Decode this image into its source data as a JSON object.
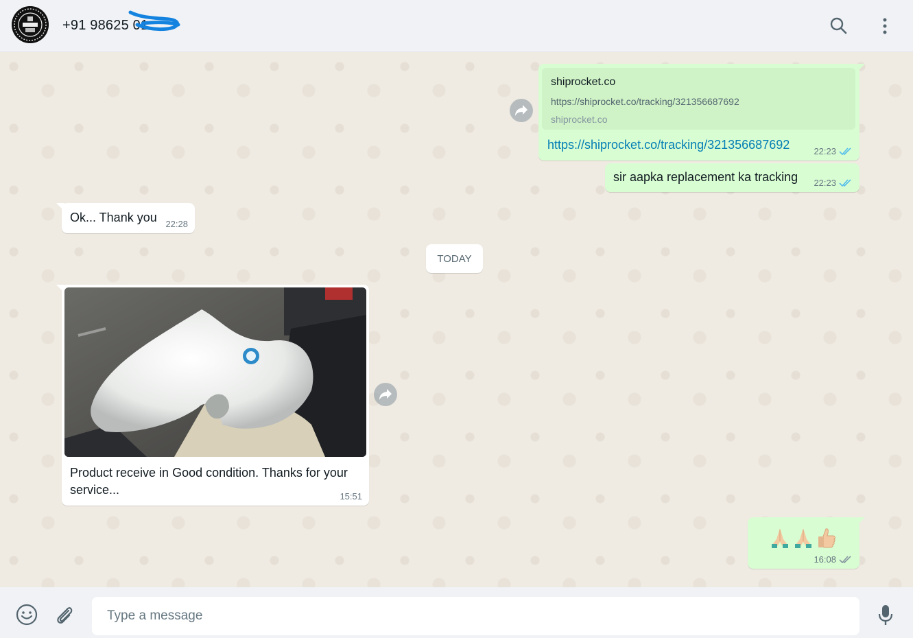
{
  "header": {
    "contact_name": "+91 98625 01",
    "search_icon": "search-icon",
    "menu_icon": "kebab-menu-icon"
  },
  "messages": {
    "link_preview": {
      "title": "shiprocket.co",
      "description": "https://shiprocket.co/tracking/321356687692",
      "host": "shiprocket.co",
      "link_text": "https://shiprocket.co/tracking/321356687692",
      "time": "22:23",
      "status": "read"
    },
    "tracking": {
      "text": "sir aapka replacement ka tracking",
      "time": "22:23",
      "status": "read"
    },
    "ok": {
      "text": "Ok... Thank you",
      "time": "22:28"
    },
    "date_divider": "TODAY",
    "photo": {
      "caption": "Product receive in Good condition. Thanks for your service...",
      "time": "15:51"
    },
    "emoji": {
      "emojis": "🙏🙏👍",
      "time": "16:08",
      "status": "read"
    }
  },
  "footer": {
    "placeholder": "Type a message",
    "value": ""
  },
  "colors": {
    "outgoing_bubble": "#d9fdd3",
    "incoming_bubble": "#ffffff",
    "link": "#027eb5",
    "read_tick": "#53bdeb",
    "chat_background": "#efeae2"
  }
}
